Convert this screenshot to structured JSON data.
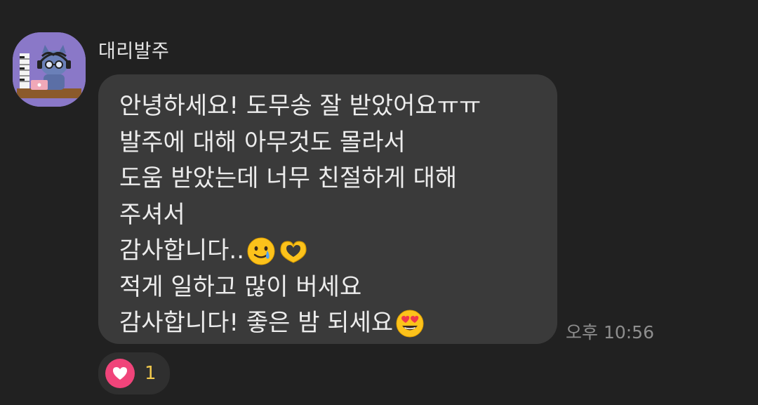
{
  "message": {
    "sender": "대리발주",
    "lines": [
      "안녕하세요! 도무송 잘 받았어요ㅠㅠ",
      "발주에 대해 아무것도 몰라서",
      "도움 받았는데 너무 친절하게 대해",
      "주셔서",
      "감사합니다..",
      "적게 일하고 많이 버세요",
      "감사합니다! 좋은 밤 되세요"
    ],
    "emoji": {
      "line5": [
        "smiling-face-with-tear",
        "heart-hands"
      ],
      "line7": [
        "smiling-face-with-heart-eyes"
      ]
    },
    "time": "오후 10:56"
  },
  "reaction": {
    "icon": "heart-icon",
    "count": "1",
    "badge_color": "#f0447a",
    "count_color": "#f2c94c"
  },
  "colors": {
    "background": "#212121",
    "bubble": "#3a3a3a",
    "avatar_bg": "#8a78c8"
  }
}
